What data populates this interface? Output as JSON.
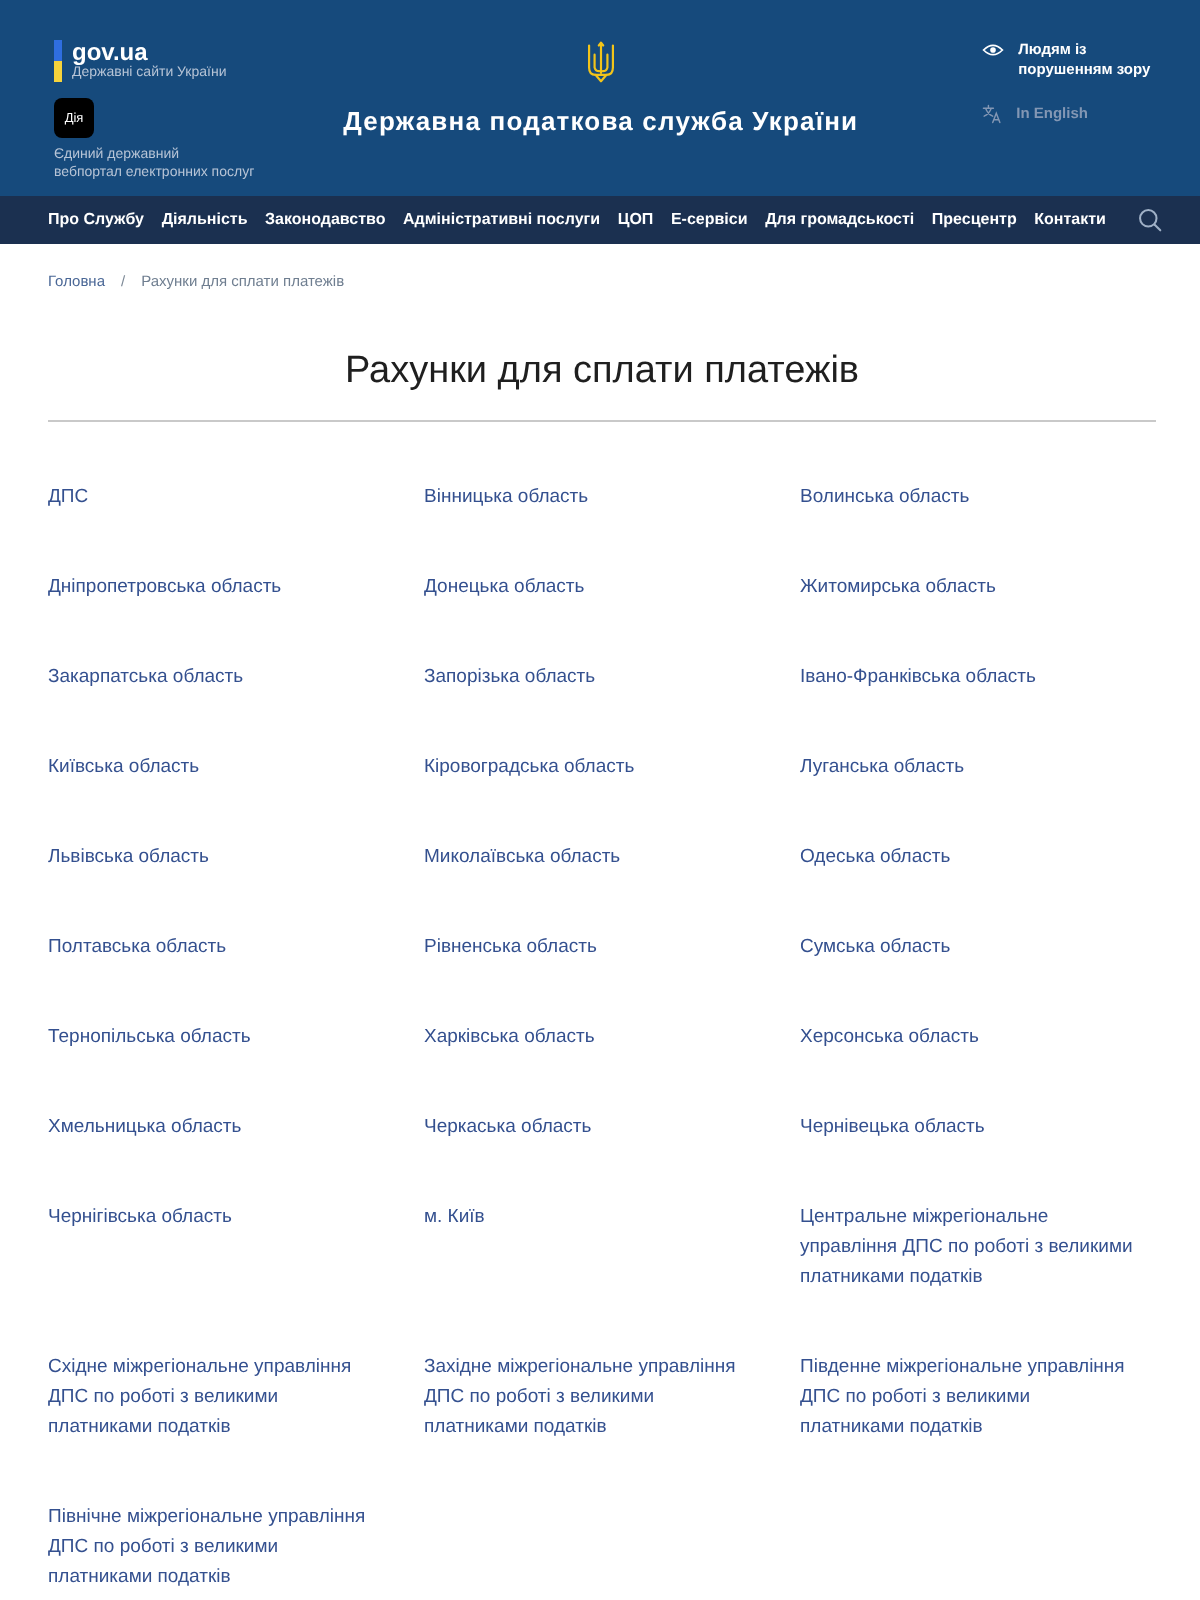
{
  "header": {
    "gov_logo": {
      "name": "gov.ua",
      "tagline": "Державні сайти України"
    },
    "diia": {
      "logo": "Дія",
      "caption_lines": [
        "Єдиний державний",
        "вебпортал електронних послуг"
      ]
    },
    "site_title": "Державна податкова служба України",
    "accessibility_link": {
      "lines": [
        "Людям із",
        "порушенням зору"
      ]
    },
    "language_link": {
      "label": "In English"
    }
  },
  "nav": {
    "items": [
      {
        "label": "Про Службу"
      },
      {
        "label": "Діяльність"
      },
      {
        "label": "Законодавство"
      },
      {
        "label": "Адміністративні послуги"
      },
      {
        "label": "ЦОП"
      },
      {
        "label": "Е-сервіси"
      },
      {
        "label": "Для громадськості"
      },
      {
        "label": "Пресцентр"
      },
      {
        "label": "Контакти"
      }
    ]
  },
  "breadcrumb": {
    "separator": "/",
    "items": [
      {
        "label": "Головна",
        "kind": "link"
      },
      {
        "label": "Рахунки для сплати платежів",
        "kind": "current"
      }
    ]
  },
  "page_title": "Рахунки для сплати платежів",
  "accounts": [
    {
      "label": "ДПС"
    },
    {
      "label": "Вінницька область"
    },
    {
      "label": "Волинська область"
    },
    {
      "label": "Дніпропетровська область"
    },
    {
      "label": "Донецька область"
    },
    {
      "label": "Житомирська область"
    },
    {
      "label": "Закарпатська область"
    },
    {
      "label": "Запорізька область"
    },
    {
      "label": "Івано-Франківська область"
    },
    {
      "label": "Київська область"
    },
    {
      "label": "Кіровоградська область"
    },
    {
      "label": "Луганська область"
    },
    {
      "label": "Львівська область"
    },
    {
      "label": "Миколаївська область"
    },
    {
      "label": "Одеська область"
    },
    {
      "label": "Полтавська область"
    },
    {
      "label": "Рівненська область"
    },
    {
      "label": "Сумська область"
    },
    {
      "label": "Тернопільська область"
    },
    {
      "label": "Харківська область"
    },
    {
      "label": "Херсонська область"
    },
    {
      "label": "Хмельницька область"
    },
    {
      "label": "Черкаська область"
    },
    {
      "label": "Чернівецька область"
    },
    {
      "label": "Чернігівська область"
    },
    {
      "label": "м. Київ"
    },
    {
      "label": "Центральне міжрегіональне управління ДПС по роботі з великими платниками податків"
    },
    {
      "label": "Східне міжрегіональне управління ДПС по роботі з великими платниками податків"
    },
    {
      "label": "Західне міжрегіональне управління ДПС по роботі з великими платниками податків"
    },
    {
      "label": "Південне міжрегіональне управління ДПС по роботі з великими платниками податків"
    },
    {
      "label": "Північне міжрегіональне управління ДПС по роботі з великими платниками податків"
    }
  ]
}
